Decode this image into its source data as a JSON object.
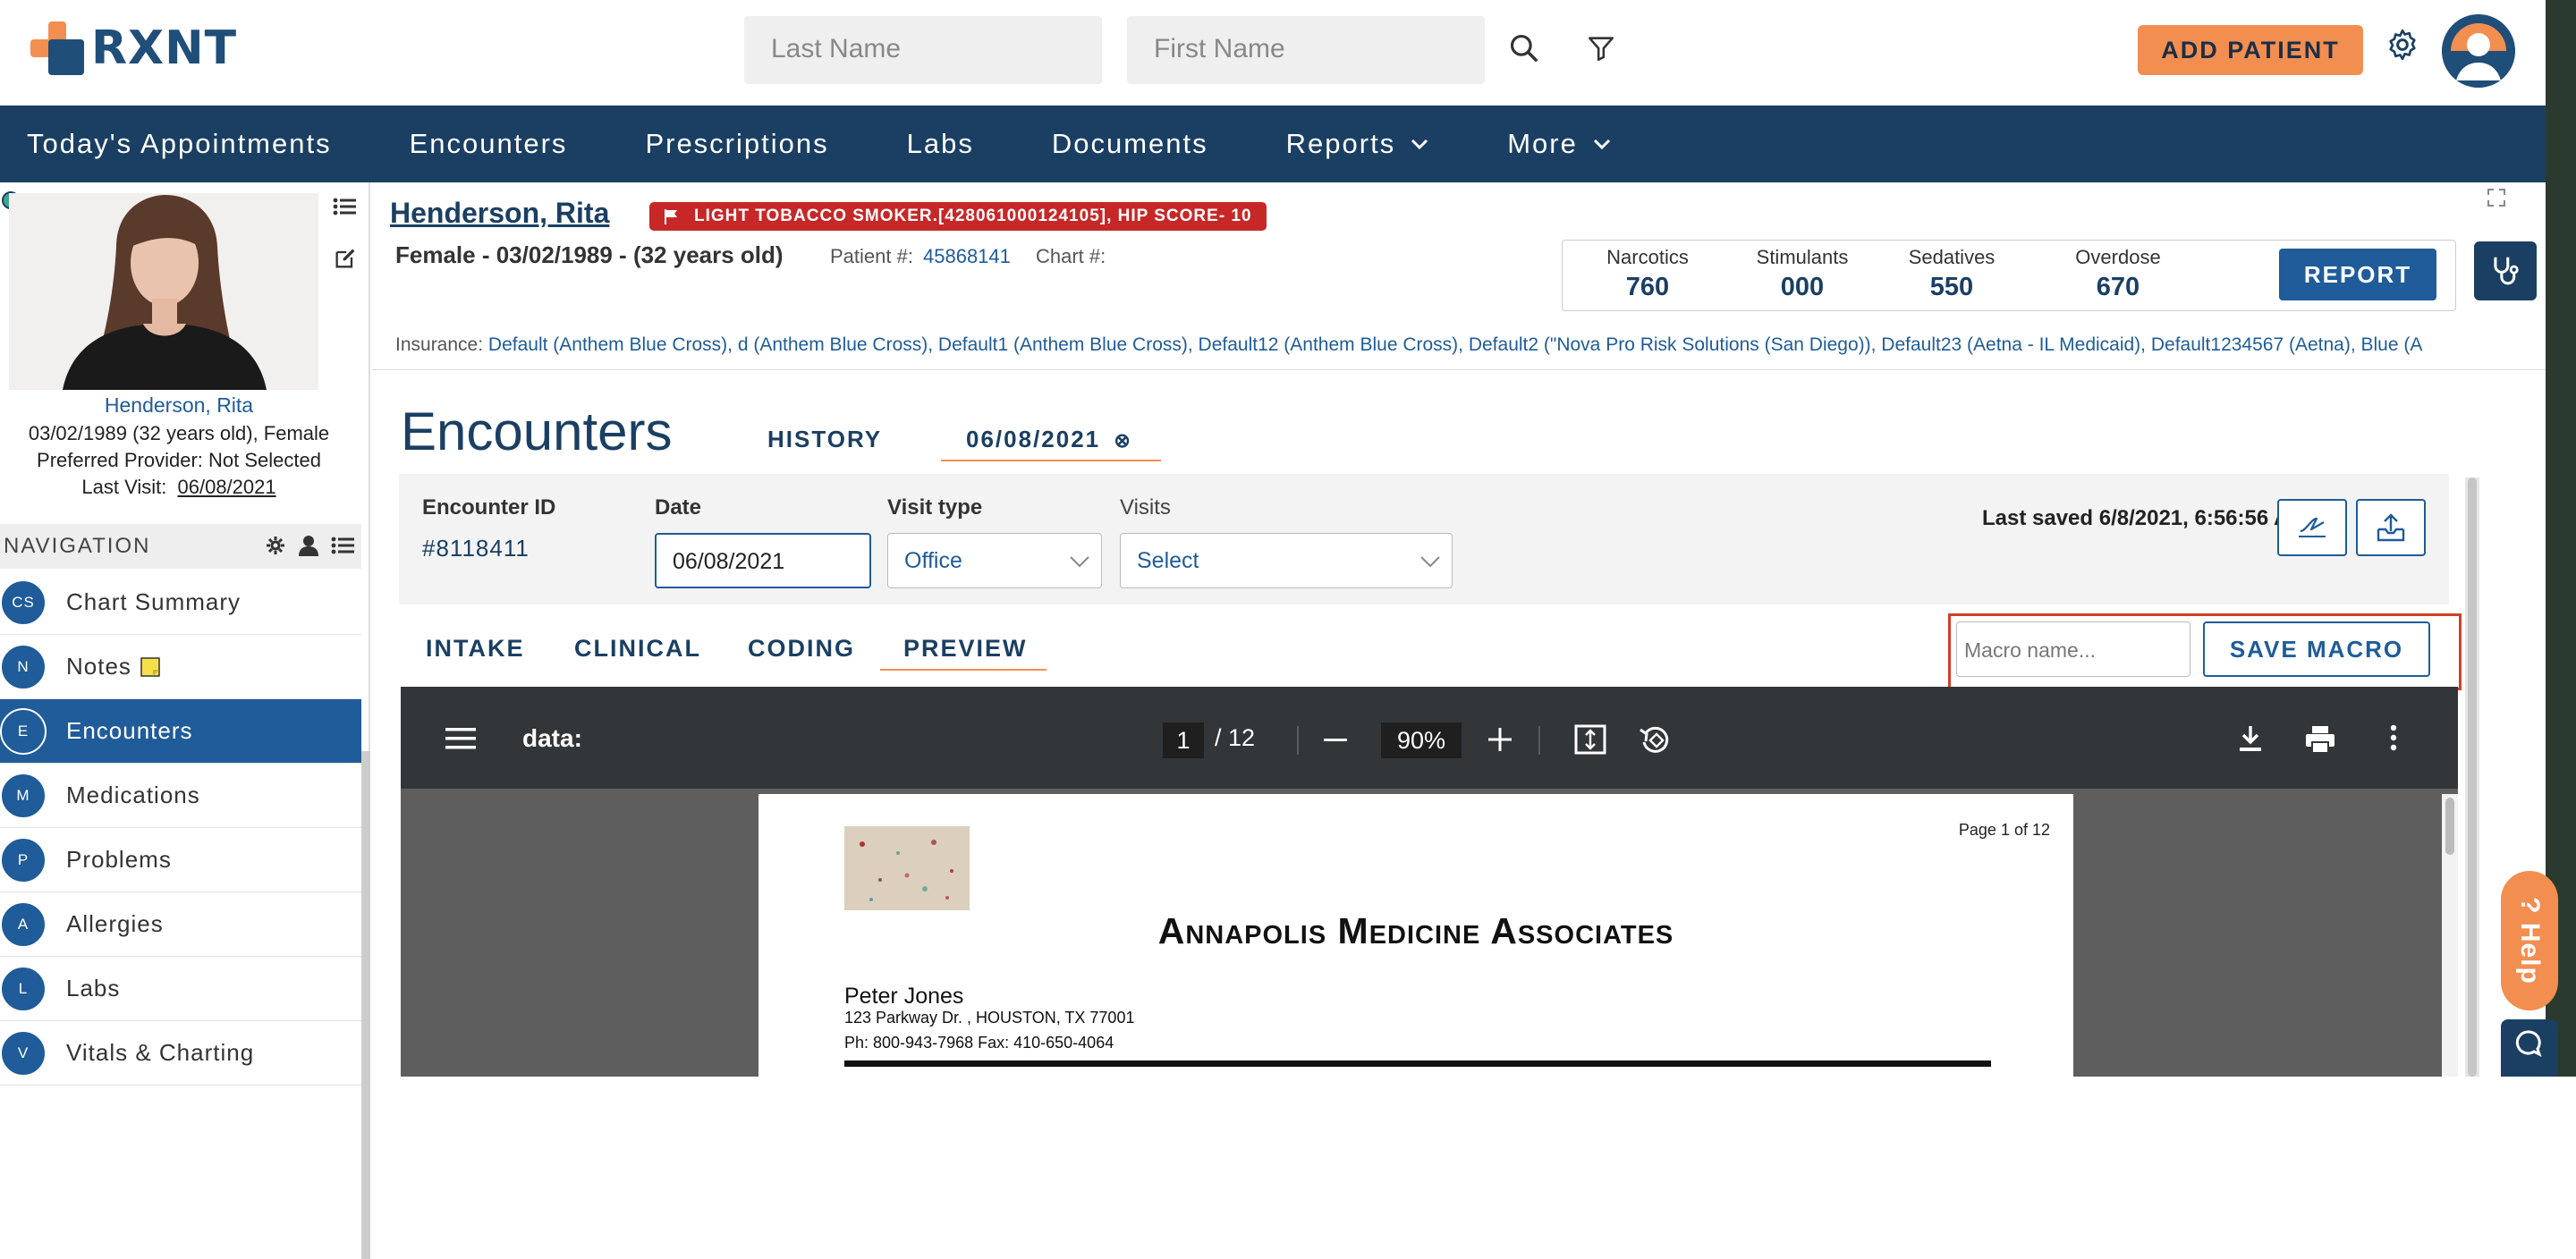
{
  "app": {
    "logo_text": "RXNT",
    "accent": "#f28e50",
    "brand": "#1b3f63"
  },
  "search": {
    "last_name_placeholder": "Last Name",
    "first_name_placeholder": "First Name"
  },
  "header": {
    "add_patient_label": "ADD PATIENT"
  },
  "nav": {
    "items": [
      {
        "label": "Today's Appointments",
        "dropdown": false
      },
      {
        "label": "Encounters",
        "dropdown": false
      },
      {
        "label": "Prescriptions",
        "dropdown": false
      },
      {
        "label": "Labs",
        "dropdown": false
      },
      {
        "label": "Documents",
        "dropdown": false
      },
      {
        "label": "Reports",
        "dropdown": true
      },
      {
        "label": "More",
        "dropdown": true
      }
    ]
  },
  "patient": {
    "name": "Henderson, Rita",
    "flag": "LIGHT TOBACCO SMOKER.[428061000124105], HIP SCORE- 10",
    "demographics": "Female - 03/02/1989 - (32 years old)",
    "patient_num_label": "Patient #:",
    "patient_num": "45868141",
    "chart_num_label": "Chart #:",
    "side_name": "Henderson, Rita",
    "side_dob": "03/02/1989 (32 years old), Female",
    "side_provider": "Preferred Provider: Not Selected",
    "side_last_visit_label": "Last Visit:",
    "side_last_visit": "06/08/2021",
    "insurance_label": "Insurance:",
    "insurance_value": "Default (Anthem Blue Cross), d (Anthem Blue Cross), Default1 (Anthem Blue Cross), Default12 (Anthem Blue Cross), Default2 (\"Nova Pro Risk Solutions (San Diego)), Default23 (Aetna - IL Medicaid), Default1234567 (Aetna), Blue (A"
  },
  "pdmp": {
    "cols": [
      {
        "label": "Narcotics",
        "value": "760"
      },
      {
        "label": "Stimulants",
        "value": "000"
      },
      {
        "label": "Sedatives",
        "value": "550"
      },
      {
        "label": "Overdose",
        "value": "670"
      }
    ],
    "report_label": "REPORT"
  },
  "sidebar": {
    "header": "NAVIGATION",
    "items": [
      {
        "badge": "CS",
        "label": "Chart Summary",
        "active": false
      },
      {
        "badge": "N",
        "label": "Notes",
        "active": false
      },
      {
        "badge": "E",
        "label": "Encounters",
        "active": true
      },
      {
        "badge": "M",
        "label": "Medications",
        "active": false
      },
      {
        "badge": "P",
        "label": "Problems",
        "active": false
      },
      {
        "badge": "A",
        "label": "Allergies",
        "active": false
      },
      {
        "badge": "L",
        "label": "Labs",
        "active": false
      },
      {
        "badge": "V",
        "label": "Vitals & Charting",
        "active": false
      }
    ]
  },
  "encounter": {
    "title": "Encounters",
    "tab_history": "HISTORY",
    "tab_date": "06/08/2021",
    "id_label": "Encounter ID",
    "id_value": "#8118411",
    "date_label": "Date",
    "date_value": "06/08/2021",
    "visit_type_label": "Visit type",
    "visit_type_value": "Office",
    "visits_label": "Visits",
    "visits_value": "Select",
    "last_saved": "Last saved 6/8/2021, 6:56:56 AM",
    "subtabs": [
      "INTAKE",
      "CLINICAL",
      "CODING",
      "PREVIEW"
    ],
    "macro_placeholder": "Macro name...",
    "save_macro_label": "SAVE MACRO"
  },
  "viewer": {
    "doc_title": "data:",
    "page_current": "1",
    "page_total": "/ 12",
    "zoom": "90%",
    "page_label": "Page 1 of 12",
    "practice": "Annapolis Medicine Associates",
    "doctor": "Peter Jones",
    "address": "123 Parkway Dr. , HOUSTON, TX 77001",
    "phone": "Ph: 800-943-7968 Fax: 410-650-4064"
  },
  "help": {
    "label": "? Help"
  }
}
